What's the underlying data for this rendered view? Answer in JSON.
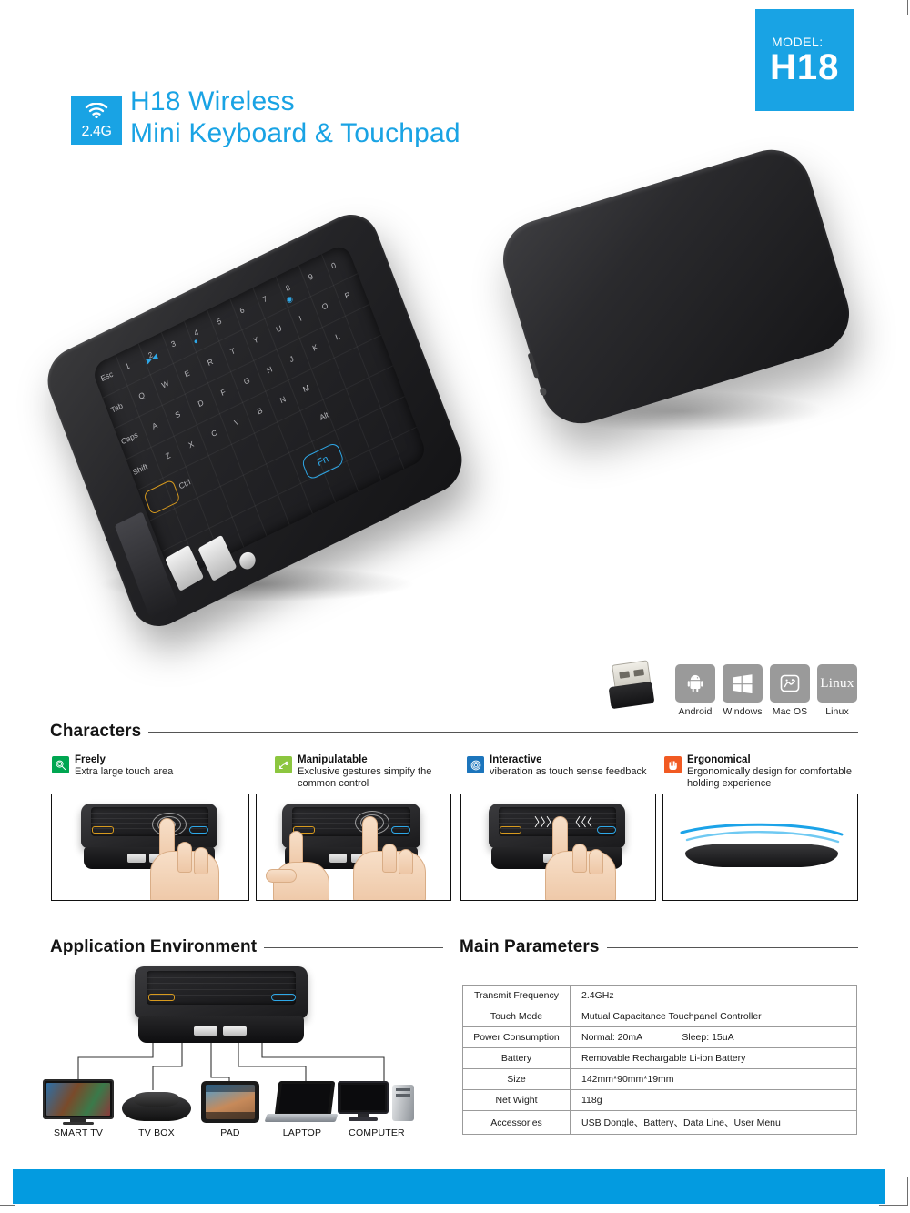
{
  "header": {
    "badge_wifi": "wifi-icon",
    "badge_text": "2.4G",
    "title_line1": "H18 Wireless",
    "title_line2": "Mini Keyboard & Touchpad",
    "model_label": "MODEL:",
    "model_value": "H18",
    "brand_blue": "#19A3E4"
  },
  "os_support": {
    "dongle": "usb-dongle",
    "items": [
      {
        "name": "Android",
        "icon": "android-icon"
      },
      {
        "name": "Windows",
        "icon": "windows-icon"
      },
      {
        "name": "Mac OS",
        "icon": "macos-icon"
      },
      {
        "name": "Linux",
        "icon": "linux-icon"
      }
    ]
  },
  "characters": {
    "heading": "Characters",
    "features": [
      {
        "title": "Freely",
        "desc": "Extra large touch area",
        "icon": "hand-touch-icon",
        "color": "#00A651"
      },
      {
        "title": "Manipulatable",
        "desc": "Exclusive gestures simpify the common control",
        "icon": "gesture-icon",
        "color": "#8CC63F"
      },
      {
        "title": "Interactive",
        "desc": "viberation as touch sense feedback",
        "icon": "vibration-icon",
        "color": "#1C75BC"
      },
      {
        "title": "Ergonomical",
        "desc": "Ergonomically design for comfortable holding experience",
        "icon": "palm-icon",
        "color": "#F15A22"
      }
    ]
  },
  "application_environment": {
    "heading": "Application Environment",
    "devices": [
      {
        "label": "SMART TV",
        "icon": "tv-icon"
      },
      {
        "label": "TV BOX",
        "icon": "tvbox-icon"
      },
      {
        "label": "PAD",
        "icon": "tablet-icon"
      },
      {
        "label": "LAPTOP",
        "icon": "laptop-icon"
      },
      {
        "label": "COMPUTER",
        "icon": "desktop-icon"
      }
    ]
  },
  "main_parameters": {
    "heading": "Main Parameters",
    "rows": [
      {
        "key": "Transmit Frequency",
        "value": "2.4GHz"
      },
      {
        "key": "Touch Mode",
        "value": "Mutual Capacitance Touchpanel Controller"
      },
      {
        "key": "Power Consumption",
        "value": "Normal: 20mA",
        "value2": "Sleep: 15uA"
      },
      {
        "key": "Battery",
        "value": "Removable Rechargable Li-ion Battery"
      },
      {
        "key": "Size",
        "value": "142mm*90mm*19mm"
      },
      {
        "key": "Net Wight",
        "value": "118g"
      },
      {
        "key": "Accessories",
        "value": "USB Dongle、Battery、Data Line、User Menu"
      }
    ]
  },
  "keyboard_legend": {
    "modifiers": [
      "Esc",
      "Tab",
      "Caps",
      "Shift",
      "Ctrl",
      "Alt",
      "Fn"
    ],
    "number_row": [
      "1",
      "2",
      "3",
      "4",
      "5",
      "6",
      "7",
      "8",
      "9",
      "0"
    ],
    "row_q": [
      "Q",
      "W",
      "E",
      "R",
      "T",
      "Y",
      "U",
      "I",
      "O",
      "P"
    ],
    "row_a": [
      "A",
      "S",
      "D",
      "F",
      "G",
      "H",
      "J",
      "K",
      "L"
    ],
    "row_z": [
      "Z",
      "X",
      "C",
      "V",
      "B",
      "N",
      "M"
    ]
  }
}
